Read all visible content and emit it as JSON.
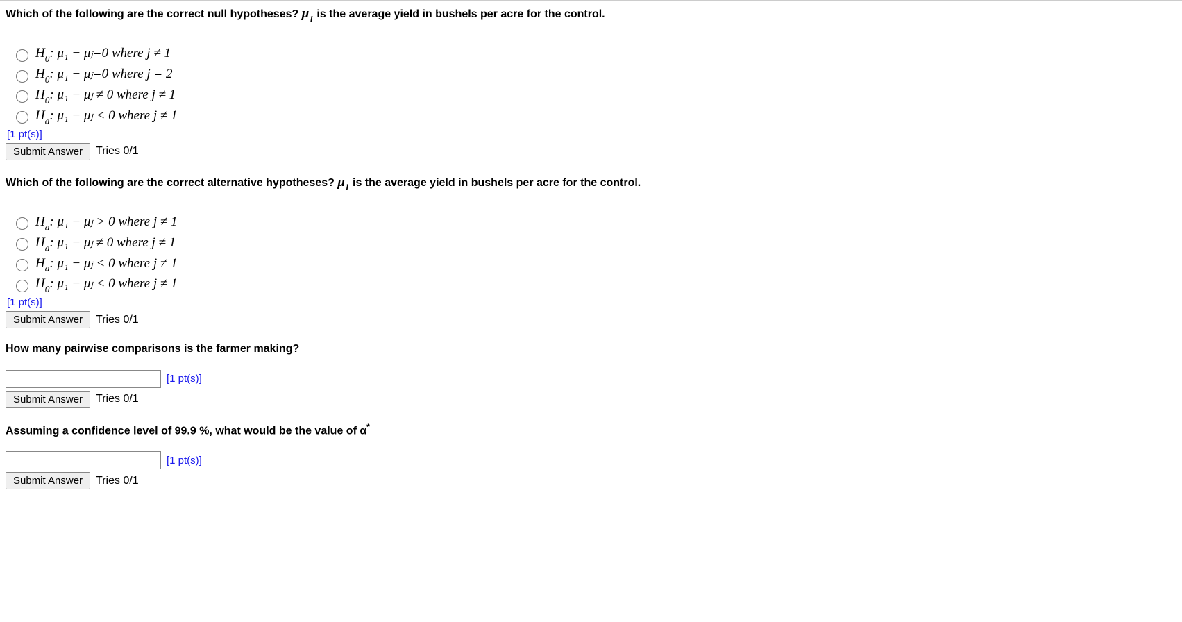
{
  "q1": {
    "prompt_prefix": "Which of the following are the correct null hypotheses? ",
    "prompt_mu": "μ",
    "prompt_sub": "1",
    "prompt_suffix": " is the average yield in bushels per acre for the control.",
    "options": {
      "a": {
        "h": "H",
        "hsub": "0",
        "body": ": μ₁ − μⱼ=0 where j ≠ 1"
      },
      "b": {
        "h": "H",
        "hsub": "0",
        "body": ": μ₁ − μⱼ=0 where j = 2"
      },
      "c": {
        "h": "H",
        "hsub": "0",
        "body": ": μ₁ − μⱼ ≠ 0 where j ≠ 1"
      },
      "d": {
        "h": "H",
        "hsub": "a",
        "body": ": μ₁ − μⱼ < 0 where j ≠ 1"
      }
    },
    "pts": "[1 pt(s)]",
    "submit": "Submit Answer",
    "tries": "Tries 0/1"
  },
  "q2": {
    "prompt_prefix": "Which of the following are the correct alternative hypotheses? ",
    "prompt_mu": "μ",
    "prompt_sub": "1",
    "prompt_suffix": " is the average yield in bushels per acre for the control.",
    "options": {
      "a": {
        "h": "H",
        "hsub": "a",
        "body": ": μ₁ − μⱼ > 0 where j ≠ 1"
      },
      "b": {
        "h": "H",
        "hsub": "a",
        "body": ": μ₁ − μⱼ ≠ 0 where j ≠ 1"
      },
      "c": {
        "h": "H",
        "hsub": "a",
        "body": ": μ₁ − μⱼ < 0 where j ≠ 1"
      },
      "d": {
        "h": "H",
        "hsub": "0",
        "body": ": μ₁ − μⱼ < 0 where j ≠ 1"
      }
    },
    "pts": "[1 pt(s)]",
    "submit": "Submit Answer",
    "tries": "Tries 0/1"
  },
  "q3": {
    "prompt": "How many pairwise comparisons is the farmer making?",
    "pts": "[1 pt(s)]",
    "submit": "Submit Answer",
    "tries": "Tries 0/1"
  },
  "q4": {
    "prompt_prefix": "Assuming a confidence level of 99.9 %, what would be the value of α",
    "prompt_sup": "*",
    "pts": "[1 pt(s)]",
    "submit": "Submit Answer",
    "tries": "Tries 0/1"
  }
}
